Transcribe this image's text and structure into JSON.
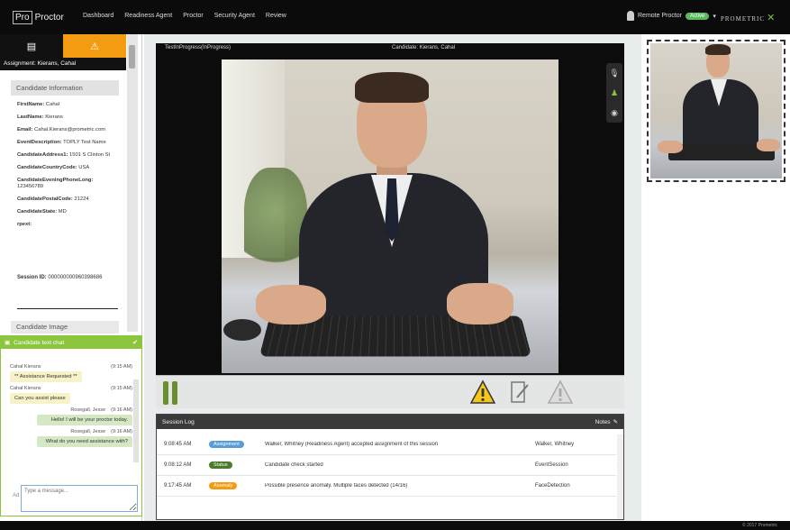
{
  "app": {
    "logo_box": "Pro",
    "logo_text": "Proctor",
    "nav": [
      "Dashboard",
      "Readiness Agent",
      "Proctor",
      "Security Agent",
      "Review"
    ],
    "user_label": "Remote Proctor",
    "user_status": "Active",
    "user_caret": "▾",
    "brand": "PROMETRIC"
  },
  "left": {
    "assignment": "Assignment: Kierans, Cahal",
    "candidate_info_title": "Candidate Information",
    "fields": [
      {
        "label": "FirstName:",
        "value": "Cahal"
      },
      {
        "label": "LastName:",
        "value": "Kierans"
      },
      {
        "label": "Email:",
        "value": "Cahal.Kierans@prometric.com"
      },
      {
        "label": "EventDescription:",
        "value": "TOPLY Test Name"
      },
      {
        "label": "CandidateAddress1:",
        "value": "1501 S Clinton St"
      },
      {
        "label": "CandidateCountryCode:",
        "value": "USA"
      },
      {
        "label": "CandidateEveningPhoneLong:",
        "value": "123456789"
      },
      {
        "label": "CandidatePostalCode:",
        "value": "21224"
      },
      {
        "label": "CandidateState:",
        "value": "MD"
      },
      {
        "label": "rpext:",
        "value": ""
      }
    ],
    "session_label": "Session ID:",
    "session_value": "000000000960398686",
    "candidate_image_title": "Candidate Image"
  },
  "chat": {
    "title": "Candidate text chat",
    "toggle": "✔",
    "messages": [
      {
        "type": "meta",
        "who": "Cahal Kierans",
        "time": "(9:15 AM)"
      },
      {
        "type": "in",
        "text": "** Assistance Requested **"
      },
      {
        "type": "meta",
        "who": "Cahal Kierans",
        "time": "(9:15 AM)"
      },
      {
        "type": "in",
        "text": "Can you assist please"
      },
      {
        "type": "meta",
        "who": "Rosegall, Jesse",
        "time": "(9:16 AM)"
      },
      {
        "type": "out",
        "text": "Hello! I will be your proctor today."
      },
      {
        "type": "meta",
        "who": "Rosegall, Jesse",
        "time": "(9:16 AM)"
      },
      {
        "type": "out",
        "text": "What do you need assistance with?"
      }
    ],
    "input_placeholder": "Type a message...",
    "side_label": "Ad"
  },
  "video": {
    "state": "TestInProgress(InProgress)",
    "candidate": "Candidate: Kierans, Cahal",
    "side_buttons": [
      "mic-icon",
      "person-icon",
      "camera-icon"
    ]
  },
  "controls": {
    "pause": "pause-icon",
    "warn": "warning-icon",
    "note": "note-edit-icon",
    "warn_inactive": "warning-outline-icon"
  },
  "log": {
    "title": "Session Log",
    "notes_label": "Notes",
    "rows": [
      {
        "time": "9:08:45 AM",
        "badge": "Assignment",
        "badge_color": "#5b9bd5",
        "message": "Walker, Whitney (Readiness Agent) accepted assignment of this session",
        "source": "Walker, Whitney"
      },
      {
        "time": "9:08:12 AM",
        "badge": "Status",
        "badge_color": "#4a7a2a",
        "message": "Candidate check started",
        "source": "EventSession"
      },
      {
        "time": "9:17:45 AM",
        "badge": "Anomaly",
        "badge_color": "#f39c12",
        "message": "Possible presence anomaly. Multiple faces detected (14/16)",
        "source": "FaceDetection"
      }
    ]
  },
  "footer": {
    "copyright": "© 2017 Prometric"
  }
}
